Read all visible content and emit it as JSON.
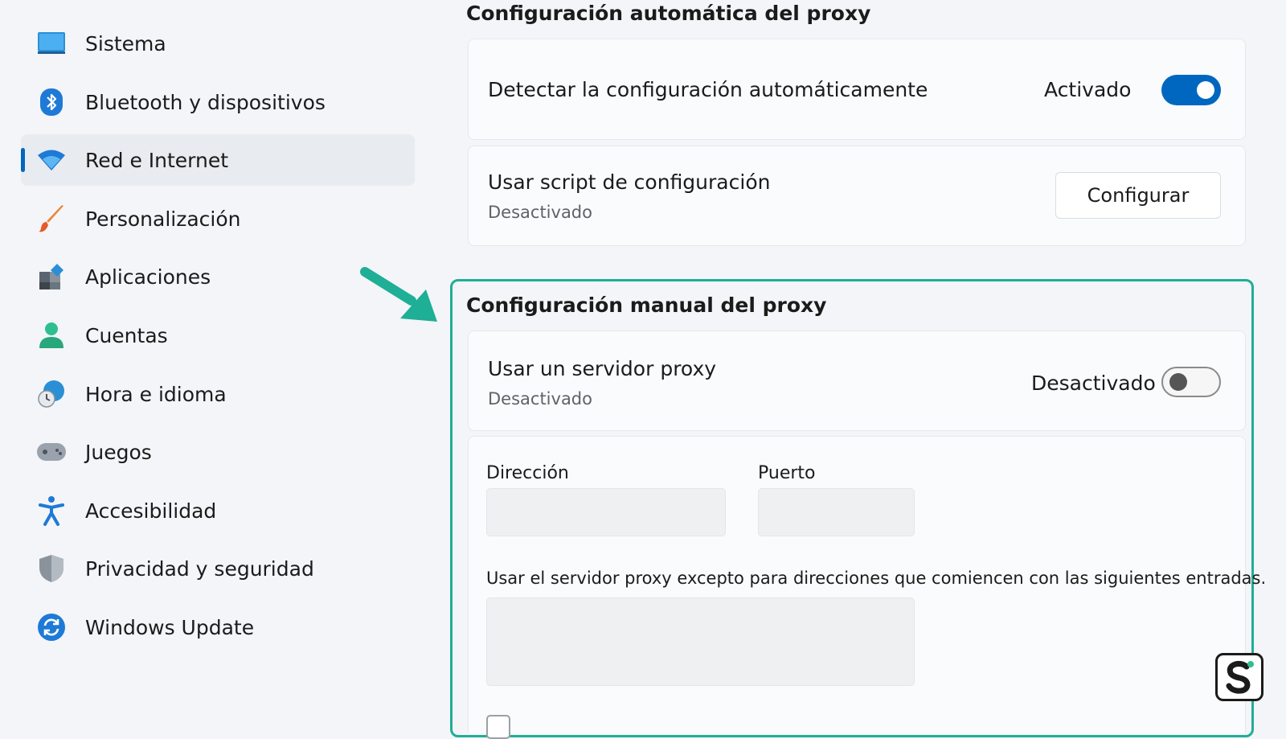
{
  "sidebar": {
    "items": [
      {
        "label": "Sistema",
        "icon": "monitor-icon"
      },
      {
        "label": "Bluetooth y dispositivos",
        "icon": "bluetooth-icon"
      },
      {
        "label": "Red e Internet",
        "icon": "wifi-icon",
        "active": true
      },
      {
        "label": "Personalización",
        "icon": "brush-icon"
      },
      {
        "label": "Aplicaciones",
        "icon": "apps-icon"
      },
      {
        "label": "Cuentas",
        "icon": "person-icon"
      },
      {
        "label": "Hora e idioma",
        "icon": "clock-globe-icon"
      },
      {
        "label": "Juegos",
        "icon": "gamepad-icon"
      },
      {
        "label": "Accesibilidad",
        "icon": "accessibility-icon"
      },
      {
        "label": "Privacidad y seguridad",
        "icon": "shield-icon"
      },
      {
        "label": "Windows Update",
        "icon": "update-icon"
      }
    ]
  },
  "auto_proxy": {
    "title": "Configuración automática del proxy",
    "detect": {
      "label": "Detectar la configuración automáticamente",
      "state": "Activado",
      "on": true
    },
    "script": {
      "label": "Usar script de configuración",
      "sub": "Desactivado",
      "button": "Configurar"
    }
  },
  "manual_proxy": {
    "title": "Configuración manual del proxy",
    "use_proxy": {
      "label": "Usar un servidor proxy",
      "sub": "Desactivado",
      "state": "Desactivado",
      "on": false
    },
    "address_label": "Dirección",
    "port_label": "Puerto",
    "address_value": "",
    "port_value": "",
    "exceptions_desc": "Usar el servidor proxy excepto para direcciones que comiencen con las siguientes entradas.",
    "exceptions_value": ""
  },
  "colors": {
    "accent": "#0067c0",
    "highlight": "#1fae96"
  },
  "annotation": {
    "icon": "arrow-annotation-icon"
  },
  "logo": {
    "icon": "s-logo-icon"
  }
}
